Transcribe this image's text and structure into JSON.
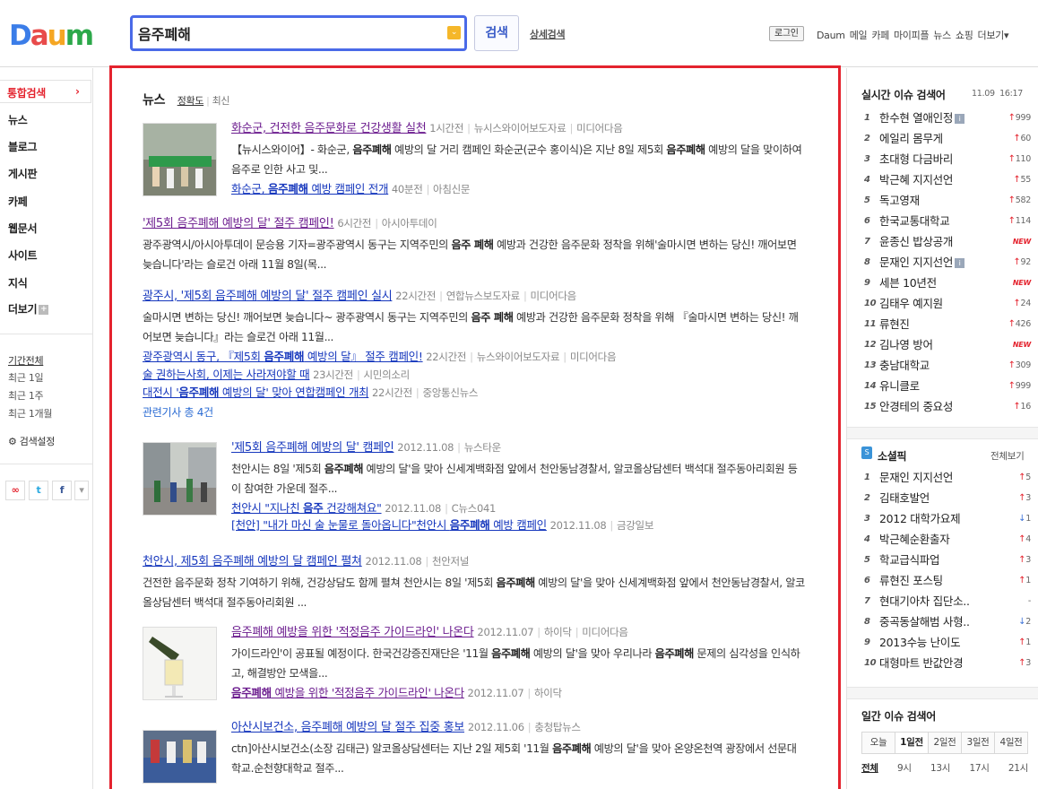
{
  "header": {
    "search_value": "음주폐해",
    "search_button": "검색",
    "advanced_search": "상세검색",
    "login": "로그인",
    "gnb": [
      "Daum",
      "메일",
      "카페",
      "마이피플",
      "뉴스",
      "쇼핑",
      "더보기▾"
    ]
  },
  "sidebar": {
    "active": "통합검색",
    "items": [
      "뉴스",
      "블로그",
      "게시판",
      "카페",
      "웹문서",
      "사이트",
      "지식",
      "더보기"
    ],
    "periods": [
      "기간전체",
      "최근 1일",
      "최근 1주",
      "최근 1개월"
    ],
    "settings": "검색설정"
  },
  "news": {
    "title": "뉴스",
    "sort_accuracy": "정확도",
    "sort_recent": "최신",
    "related_link": "관련기사 총 4건",
    "articles": [
      {
        "title_pre": "화순군, 건전한 ",
        "title_kw": "음주문화",
        "title_post": "로 건강생활 실천",
        "meta": [
          "1시간전",
          "뉴시스와이어보도자료",
          "미디어다음"
        ],
        "desc1": "【뉴시스와이어】- 화순군, ",
        "kw1": "음주폐해",
        "desc2": " 예방의 달 거리 캠페인 화순군(군수 홍이식)은 지난 8일 제5회 ",
        "kw2": "음주폐해",
        "desc3": " 예방의 달을 맞이하여 음주로 인한 사고 및...",
        "sub_pre": "화순군, ",
        "sub_kw": "음주폐해",
        "sub_post": " 예방 캠페인 전개",
        "sub_meta": [
          "40분전",
          "아침신문"
        ]
      },
      {
        "title_pre": "'제5회 ",
        "title_kw": "음주폐해",
        "title_post": " 예방의 달' 절주 캠페인!",
        "meta": [
          "6시간전",
          "아시아투데이"
        ],
        "desc1": "광주광역시/아시아투데이 문승용 기자=광주광역시 동구는 지역주민의 ",
        "kw1": "음주 폐해",
        "desc2": " 예방과 건강한 음주문화 정착을 위해'술마시면 변하는 당신! 깨어보면 늦습니다'라는 슬로건 아래 11월 8일(목..."
      },
      {
        "title_pre": "광주시, '제5회 ",
        "title_kw": "음주폐해",
        "title_post": " 예방의 달' 절주 캠페인 실시",
        "meta": [
          "22시간전",
          "연합뉴스보도자료",
          "미디어다음"
        ],
        "desc1": "술마시면 변하는 당신! 깨어보면 늦습니다~ 광주광역시 동구는 지역주민의 ",
        "kw1": "음주 폐해",
        "desc2": " 예방과 건강한 음주문화 정착을 위해 『술마시면 변하는 당신! 깨어보면 늦습니다』라는 슬로건 아래 11월...",
        "subs": [
          {
            "pre": "광주광역시 동구, 『제5회 ",
            "kw": "음주폐해",
            "post": " 예방의 달』 절주 캠페인!",
            "meta": [
              "22시간전",
              "뉴스와이어보도자료",
              "미디어다음"
            ]
          },
          {
            "pre": "술 권하는사회, 이제는 사라져야할 때",
            "kw": "",
            "post": "",
            "meta": [
              "23시간전",
              "시민의소리"
            ]
          },
          {
            "pre": "대전시 '",
            "kw": "음주폐해",
            "post": " 예방의 달' 맞아 연합캠페인 개최",
            "meta": [
              "22시간전",
              "중앙통신뉴스"
            ]
          }
        ]
      },
      {
        "title_pre": "'제5회 ",
        "title_kw": "음주폐해",
        "title_post": " 예방의 달' 캠페인",
        "meta": [
          "2012.11.08",
          "뉴스타운"
        ],
        "desc1": "천안시는 8일 '제5회 ",
        "kw1": "음주폐해",
        "desc2": " 예방의 달'을 맞아 신세계백화점 앞에서 천안동남경찰서, 알코올상담센터 백석대 절주동아리회원 등이 참여한 가운데 절주...",
        "subs": [
          {
            "pre": "천안시 \"지나친 ",
            "kw": "음주",
            "post": " 건강해쳐요\"",
            "meta": [
              "2012.11.08",
              "C뉴스041"
            ]
          },
          {
            "pre": "[천안] \"내가 마신 술 눈물로 돌아옵니다\"천안시 ",
            "kw": "음주폐해",
            "post": " 예방 캠페인",
            "meta": [
              "2012.11.08",
              "금강일보"
            ]
          }
        ]
      },
      {
        "title_pre": "천안시, 제5회 ",
        "title_kw": "음주폐해",
        "title_post": " 예방의 달 캠페인 펼쳐",
        "meta": [
          "2012.11.08",
          "천안저널"
        ],
        "desc1": "건전한 음주문화 정착 기여하기 위해, 건강상담도 함께 펼쳐 천안시는 8일 '제5회 ",
        "kw1": "음주폐해",
        "desc2": " 예방의 달'을 맞아 신세계백화점 앞에서 천안동남경찰서, 알코올상담센터 백석대 절주동아리회원 ..."
      },
      {
        "title_pre": "",
        "title_kw": "음주폐해",
        "title_post": " 예방을 위한 '적정음주 가이드라인' 나온다",
        "meta": [
          "2012.11.07",
          "하이닥",
          "미디어다음"
        ],
        "desc1": "가이드라인'이 공표될 예정이다. 한국건강증진재단은 '11월 ",
        "kw1": "음주폐해",
        "desc2": " 예방의 달'을 맞아 우리나라 ",
        "kw2": "음주폐해",
        "desc3": " 문제의 심각성을 인식하고, 해결방안 모색을...",
        "sub_pre": "",
        "sub_kw": "음주폐해",
        "sub_post": " 예방을 위한 '적정음주 가이드라인' 나온다",
        "sub_meta": [
          "2012.11.07",
          "하이닥"
        ]
      },
      {
        "title_pre": "아산시보건소, ",
        "title_kw": "음주폐해",
        "title_post": " 예방의 달 절주 집중 홍보",
        "meta": [
          "2012.11.06",
          "충청탑뉴스"
        ],
        "desc1": "ctn]아산시보건소(소장 김태근) 알코올상담센터는 지난 2일 제5회 '11월 ",
        "kw1": "음주폐해",
        "desc2": " 예방의 달'을 맞아 온양온천역 광장에서 선문대학교.순천향대학교 절주..."
      }
    ]
  },
  "realtime": {
    "title": "실시간 이슈 검색어",
    "date": "11.09",
    "time": "16:17",
    "items": [
      {
        "rank": "1",
        "kw": "한수현 열애인정",
        "badge": true,
        "dir": "up",
        "val": "999"
      },
      {
        "rank": "2",
        "kw": "에일리 몸무게",
        "dir": "up",
        "val": "60"
      },
      {
        "rank": "3",
        "kw": "초대형 다금바리",
        "dir": "up",
        "val": "110"
      },
      {
        "rank": "4",
        "kw": "박근혜 지지선언",
        "dir": "up",
        "val": "55"
      },
      {
        "rank": "5",
        "kw": "독고영재",
        "dir": "up",
        "val": "582"
      },
      {
        "rank": "6",
        "kw": "한국교통대학교",
        "dir": "up",
        "val": "114"
      },
      {
        "rank": "7",
        "kw": "윤종신 밥상공개",
        "dir": "new",
        "val": "NEW"
      },
      {
        "rank": "8",
        "kw": "문재인 지지선언",
        "badge": true,
        "dir": "up",
        "val": "92"
      },
      {
        "rank": "9",
        "kw": "세븐 10년전",
        "dir": "new",
        "val": "NEW"
      },
      {
        "rank": "10",
        "kw": "김태우 예지원",
        "dir": "up",
        "val": "24"
      },
      {
        "rank": "11",
        "kw": "류현진",
        "dir": "up",
        "val": "426"
      },
      {
        "rank": "12",
        "kw": "김나영 방어",
        "dir": "new",
        "val": "NEW"
      },
      {
        "rank": "13",
        "kw": "충남대학교",
        "dir": "up",
        "val": "309"
      },
      {
        "rank": "14",
        "kw": "유니클로",
        "dir": "up",
        "val": "999"
      },
      {
        "rank": "15",
        "kw": "안경테의 중요성",
        "dir": "up",
        "val": "16"
      }
    ]
  },
  "social": {
    "title": "소셜픽",
    "more": "전체보기",
    "items": [
      {
        "rank": "1",
        "kw": "문재인 지지선언",
        "dir": "up",
        "val": "5"
      },
      {
        "rank": "2",
        "kw": "김태호발언",
        "dir": "up",
        "val": "3"
      },
      {
        "rank": "3",
        "kw": "2012 대학가요제",
        "dir": "down",
        "val": "1"
      },
      {
        "rank": "4",
        "kw": "박근혜순환출자",
        "dir": "up",
        "val": "4"
      },
      {
        "rank": "5",
        "kw": "학교급식파업",
        "dir": "up",
        "val": "3"
      },
      {
        "rank": "6",
        "kw": "류현진 포스팅",
        "dir": "up",
        "val": "1"
      },
      {
        "rank": "7",
        "kw": "현대기아차 집단소..",
        "dir": "same",
        "val": "-"
      },
      {
        "rank": "8",
        "kw": "중곡동살해범 사형..",
        "dir": "down",
        "val": "2"
      },
      {
        "rank": "9",
        "kw": "2013수능 난이도",
        "dir": "up",
        "val": "1"
      },
      {
        "rank": "10",
        "kw": "대형마트 반값안경",
        "dir": "up",
        "val": "3"
      }
    ]
  },
  "daily": {
    "title": "일간 이슈 검색어",
    "tabs": [
      "오늘",
      "1일전",
      "2일전",
      "3일전",
      "4일전"
    ],
    "hours": [
      "전체",
      "9시",
      "13시",
      "17시",
      "21시"
    ]
  }
}
